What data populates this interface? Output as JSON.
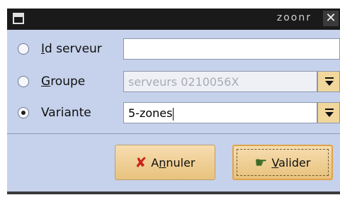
{
  "window": {
    "title": "zoonr",
    "close_glyph": "✕"
  },
  "form": {
    "rows": [
      {
        "id": "id-serveur",
        "label_accel": "I",
        "label_rest": "d serveur",
        "selected": false,
        "value": "",
        "disabled": false,
        "has_dropdown": false
      },
      {
        "id": "groupe",
        "label_accel": "G",
        "label_rest": "roupe",
        "selected": false,
        "value": "serveurs 0210056X",
        "disabled": true,
        "has_dropdown": true
      },
      {
        "id": "variante",
        "label_accel": "",
        "label_rest": "Variante",
        "selected": true,
        "value": "5-zones",
        "disabled": false,
        "has_dropdown": true
      }
    ]
  },
  "buttons": {
    "cancel": {
      "pre": "A",
      "accel": "n",
      "post": "nuler",
      "icon": "cancel-x-icon"
    },
    "ok": {
      "pre": "",
      "accel": "V",
      "post": "alider",
      "icon": "validate-hand-icon"
    }
  },
  "colors": {
    "dialog_bg": "#c6d2ec",
    "titlebar_bg": "#1a1a1a",
    "button_bg": "#f1d79c",
    "cancel_icon": "#c8251b"
  }
}
